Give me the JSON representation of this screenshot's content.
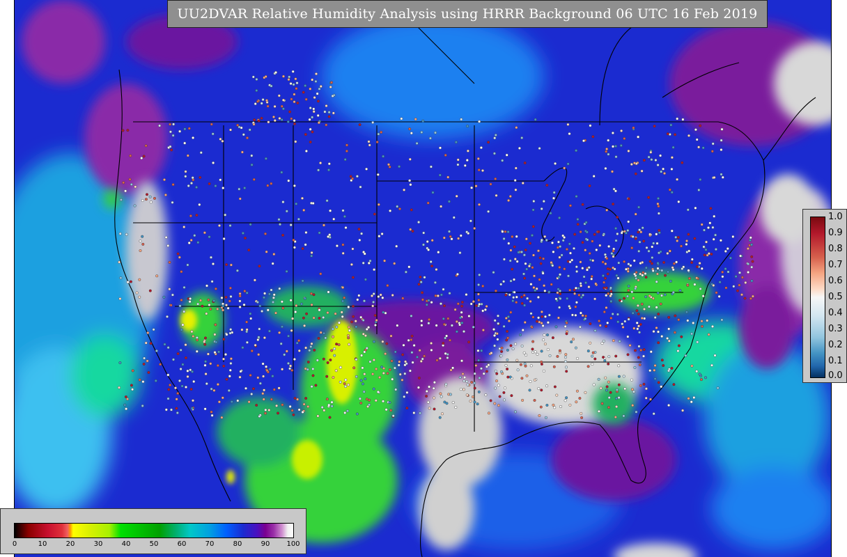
{
  "title": "UU2DVAR Relative Humidity Analysis using HRRR Background 06 UTC 16 Feb 2019",
  "obs_legend": {
    "ticks": [
      "1.0",
      "0.9",
      "0.8",
      "0.7",
      "0.6",
      "0.5",
      "0.4",
      "0.3",
      "0.2",
      "0.1",
      "0.0"
    ]
  },
  "rh_legend": {
    "ticks": [
      "0",
      "10",
      "20",
      "30",
      "40",
      "50",
      "60",
      "70",
      "80",
      "90",
      "100"
    ]
  },
  "colors": {
    "background_blue": "#1b2bd0",
    "moist_purple": "#7a1a9c",
    "saturated_white": "#d8d8d8",
    "dry_green": "#36d23a",
    "very_dry_yellow": "#e6f000",
    "ocean_cyan": "#1ea0e0"
  }
}
